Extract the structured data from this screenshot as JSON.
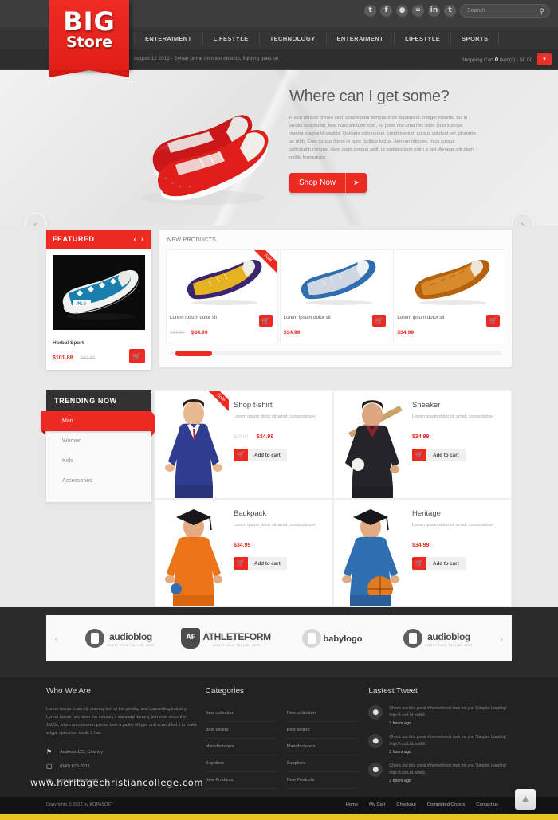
{
  "brand": {
    "line1": "BIG",
    "line2": "Store",
    "accent": "#ec2a22"
  },
  "header": {
    "social": [
      {
        "name": "twitter-icon",
        "glyph": "t"
      },
      {
        "name": "facebook-icon",
        "glyph": "f"
      },
      {
        "name": "dribbble-icon",
        "glyph": "●"
      },
      {
        "name": "google-plus-icon",
        "glyph": "∞"
      },
      {
        "name": "linkedin-icon",
        "glyph": "in"
      },
      {
        "name": "tumblr-icon",
        "glyph": "t"
      }
    ],
    "search": {
      "placeholder": "Search",
      "value": ""
    },
    "nav": [
      "ENTERAIMENT",
      "LIFESTYLE",
      "TECHNOLOGY",
      "ENTERAIMENT",
      "LIFESTYLE",
      "SPORTS"
    ],
    "ticker": "August  12  2012 - Syrian prime minister defects, fighting goes on",
    "cart": {
      "label": "Shopping Cart",
      "count": "0",
      "suffix": "item(s) - $0.00"
    }
  },
  "hero": {
    "title": "Where can I get some?",
    "body": "Fusce ultrices ornare velit, consectetur tempus eros dapibus et. Integer lobortis, dui in iaculis sollicitudin, felis nunc aliquam nibh, eu porta nisl urna nec odio. Duis suscipit viverra magna id sagittis. Quisque odio neque, condimentum cursus volutpat vel, pharetra ac nibh. Cras cursus libero id nunc facilisis luctus. Aenean ultricies, risus cursus sollicitudin congue, diam diam congue velit, ut sodales sem enim a nisl. Aenean elit diam, mollis fermentum",
    "cta": "Shop Now",
    "prev": "‹",
    "next": "›"
  },
  "featured": {
    "title": "FEATURED",
    "navs": "‹ ›",
    "product": {
      "name": "Herbal Sport",
      "price": "$101.88",
      "old_price": "$60.99"
    },
    "cart_icon": "🛒"
  },
  "new_products": {
    "title": "NEW PRODUCTS",
    "items": [
      {
        "name": "Lorem ipsum dolor sit",
        "price": "$34.99",
        "old_price": "$60.99",
        "sale": "Sale",
        "has_sale": true
      },
      {
        "name": "Lorem ipsum dolor sit",
        "price": "$34.99",
        "old_price": "",
        "sale": "",
        "has_sale": false
      },
      {
        "name": "Lorem ipsum dolor sit",
        "price": "$34.99",
        "old_price": "",
        "sale": "",
        "has_sale": false
      }
    ]
  },
  "trending": {
    "title": "TRENDING NOW",
    "categories": [
      "Man",
      "Women",
      "Kids",
      "Accessories"
    ],
    "active_index": 0,
    "cards": [
      {
        "name": "Shop t-shirt",
        "desc": "Lorem ipsum dolor sit amet, consectetuer",
        "price": "$34.99",
        "old_price": "$24.99",
        "button": "Add to cart",
        "sale": "Sale",
        "has_sale": true
      },
      {
        "name": "Sneaker",
        "desc": "Lorem ipsum dolor sit amet, consectetuer",
        "price": "$34.99",
        "old_price": "",
        "button": "Add to cart",
        "sale": "",
        "has_sale": false
      },
      {
        "name": "Backpack",
        "desc": "Lorem ipsum dolor sit amet, consectetuer",
        "price": "$34.99",
        "old_price": "",
        "button": "Add to cart",
        "sale": "",
        "has_sale": false
      },
      {
        "name": "Heritage",
        "desc": "Lorem ipsum dolor sit amet, consectetuer",
        "price": "$34.99",
        "old_price": "",
        "button": "Add to cart",
        "sale": "",
        "has_sale": false
      }
    ]
  },
  "brands": {
    "prev": "‹",
    "next": "›",
    "items": [
      {
        "name": "audioblog",
        "tagline": "INSERT YOUR TAGLINE HERE",
        "style": "circle"
      },
      {
        "name": "ATHLETEFORM",
        "tagline": "INSERT YOUR TAGLINE HERE",
        "style": "shield",
        "mark": "AF"
      },
      {
        "name": "babylogo",
        "tagline": "",
        "style": "circle"
      },
      {
        "name": "audioblog",
        "tagline": "INSERT YOUR TAGLINE HERE",
        "style": "circle"
      }
    ]
  },
  "footer": {
    "about": {
      "title": "Who We Are",
      "body": "Lorem Ipsum is simply dummy text of the printing and typesetting industry. Lorem Ipsum has been the industry's standard dummy text ever since the 1500s, when an unknown printer took a galley of type and scrambled it to make a type specimen book. It has",
      "contacts": [
        {
          "icon": "flag-icon",
          "glyph": "⚑",
          "text": "Address 123, Country"
        },
        {
          "icon": "phone-icon",
          "glyph": "▢",
          "text": "(040) 875-9211"
        },
        {
          "icon": "mail-icon",
          "glyph": "✉",
          "text": "info@kopasoft.com"
        }
      ]
    },
    "categories": {
      "title": "Categories",
      "col1": [
        "New collection",
        "Best sellers",
        "Manufacturers",
        "Suppliers",
        "New Products"
      ],
      "col2": [
        "New collection",
        "Best sellers",
        "Manufacturers",
        "Suppliers",
        "New Products"
      ]
    },
    "tweets": {
      "title": "Lastest Tweet",
      "items": [
        {
          "text": "Check out this great #themeforest item for you 'Simpler Landing' http://t.co/LbLwldb6",
          "time": "2 hours ago"
        },
        {
          "text": "Check out this great #themeforest item for you 'Simpler Landing' http://t.co/LbLwldb6",
          "time": "2 hours ago"
        },
        {
          "text": "Check out this great #themeforest item for you 'Simpler Landing' http://t.co/LbLwldb6",
          "time": "2 hours ago"
        }
      ]
    },
    "copyright": "Copyrights © 2012 by KOPASOFT",
    "links": [
      "Home",
      "My Cart",
      "Checkout",
      "Completed Orders",
      "Contact us"
    ],
    "back_to_top": "▲"
  },
  "watermark": "www.heritagechristiancollege.com"
}
